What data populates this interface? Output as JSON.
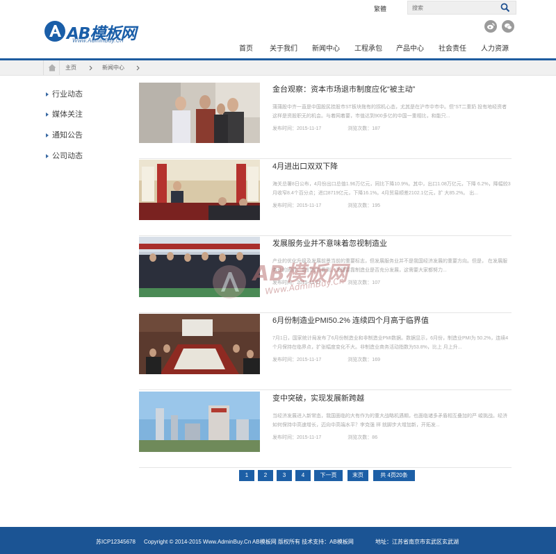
{
  "header": {
    "manage_link": "繁體",
    "search_placeholder": "搜索",
    "logo_text": "AB模板网",
    "logo_sub": "Www.AdminBuy.Cn",
    "social": [
      "weibo-icon",
      "wechat-icon"
    ]
  },
  "nav": {
    "items": [
      "首页",
      "关于我们",
      "新闻中心",
      "工程承包",
      "产品中心",
      "社会责任",
      "人力资源"
    ]
  },
  "breadcrumb": {
    "items": [
      "主页",
      "新闻中心"
    ]
  },
  "sidebar": {
    "items": [
      "行业动态",
      "媒体关注",
      "通知公告",
      "公司动态"
    ]
  },
  "news": [
    {
      "title": "金台观察：资本市场退市制度应化“被主动”",
      "desc": "蒲蒲股中齐一直是中国股民挂股市ST板块拖有的拐机心态，尤其是在沪市中市中。但“ST二重奶 投有地经资者这样是资股职无的机会。与着网着要，市值达到900多亿的中国一重相比，和能只...",
      "date_label": "发布时间：2015-11-17",
      "views_label": "浏览次数：187"
    },
    {
      "title": "4月进出口双双下降",
      "desc": "海关总署8日公布，4月份出口总值1.96万亿元，同比下降10.9%。其中，出口1.08万亿元，下降 6.2%，降幅较3月收窄8.4个百分点；进口8719亿元，下降16.1%。4月贸易顺差2102.1亿元，扩 大85.2%。 出...",
      "date_label": "发布时间：2015-11-17",
      "views_label": "浏览次数：195"
    },
    {
      "title": "发展服务业并不意味着忽视制造业",
      "desc": "产业的优化升级及发展前景当前的重要标志，但发展服务业并不是我国经济发展的重要方向。但是， 在发展服务业的同时，我们应当看到，关键要靠制造业是否充分发展，这需要大家都努力...",
      "date_label": "发布时间：2015-11-17",
      "views_label": "浏览次数：107"
    },
    {
      "title": "6月份制造业PMI50.2% 连续四个月高于临界值",
      "desc": "7月1日，国家统计局发布了6月份制造业和非制造业PMI数据。数据显示，6月份，制造业PMI为 50.2%，连续4个月保持在临界点，扩张幅度变化不大。非制造业商务活动指数为53.8%，比上 月上升...",
      "date_label": "发布时间：2015-11-17",
      "views_label": "浏览次数：169"
    },
    {
      "title": "变中突破，实现发展新跨越",
      "desc": "当经济发展进入新常态，我国面临的大有作为的重大战略机遇期，也面临诸多矛盾相互叠加的严 峻挑战。经济如何保持中高速增长，迈向中高端水平？李克强 祥 就脚步大增加新，开拓发...",
      "date_label": "发布时间：2015-11-17",
      "views_label": "浏览次数：86"
    }
  ],
  "pagination": {
    "pages": [
      "1",
      "2",
      "3",
      "4"
    ],
    "next": "下一页",
    "last": "末页",
    "total": "共 4页20条"
  },
  "footer": {
    "icp": "苏ICP12345678",
    "copyright": "Copyright © 2014-2015 Www.AdminBuy.Cn AB模板网 版权所有 技术支持：AB模板网",
    "address": "地址：江苏省南京市玄武区玄武湖"
  },
  "watermark": {
    "text": "AB模板网",
    "sub": "Www.AdminBuy.Cn"
  },
  "colors": {
    "brand": "#1d5b9f",
    "pager": "#1d5fa6",
    "footer": "#1b5494"
  }
}
